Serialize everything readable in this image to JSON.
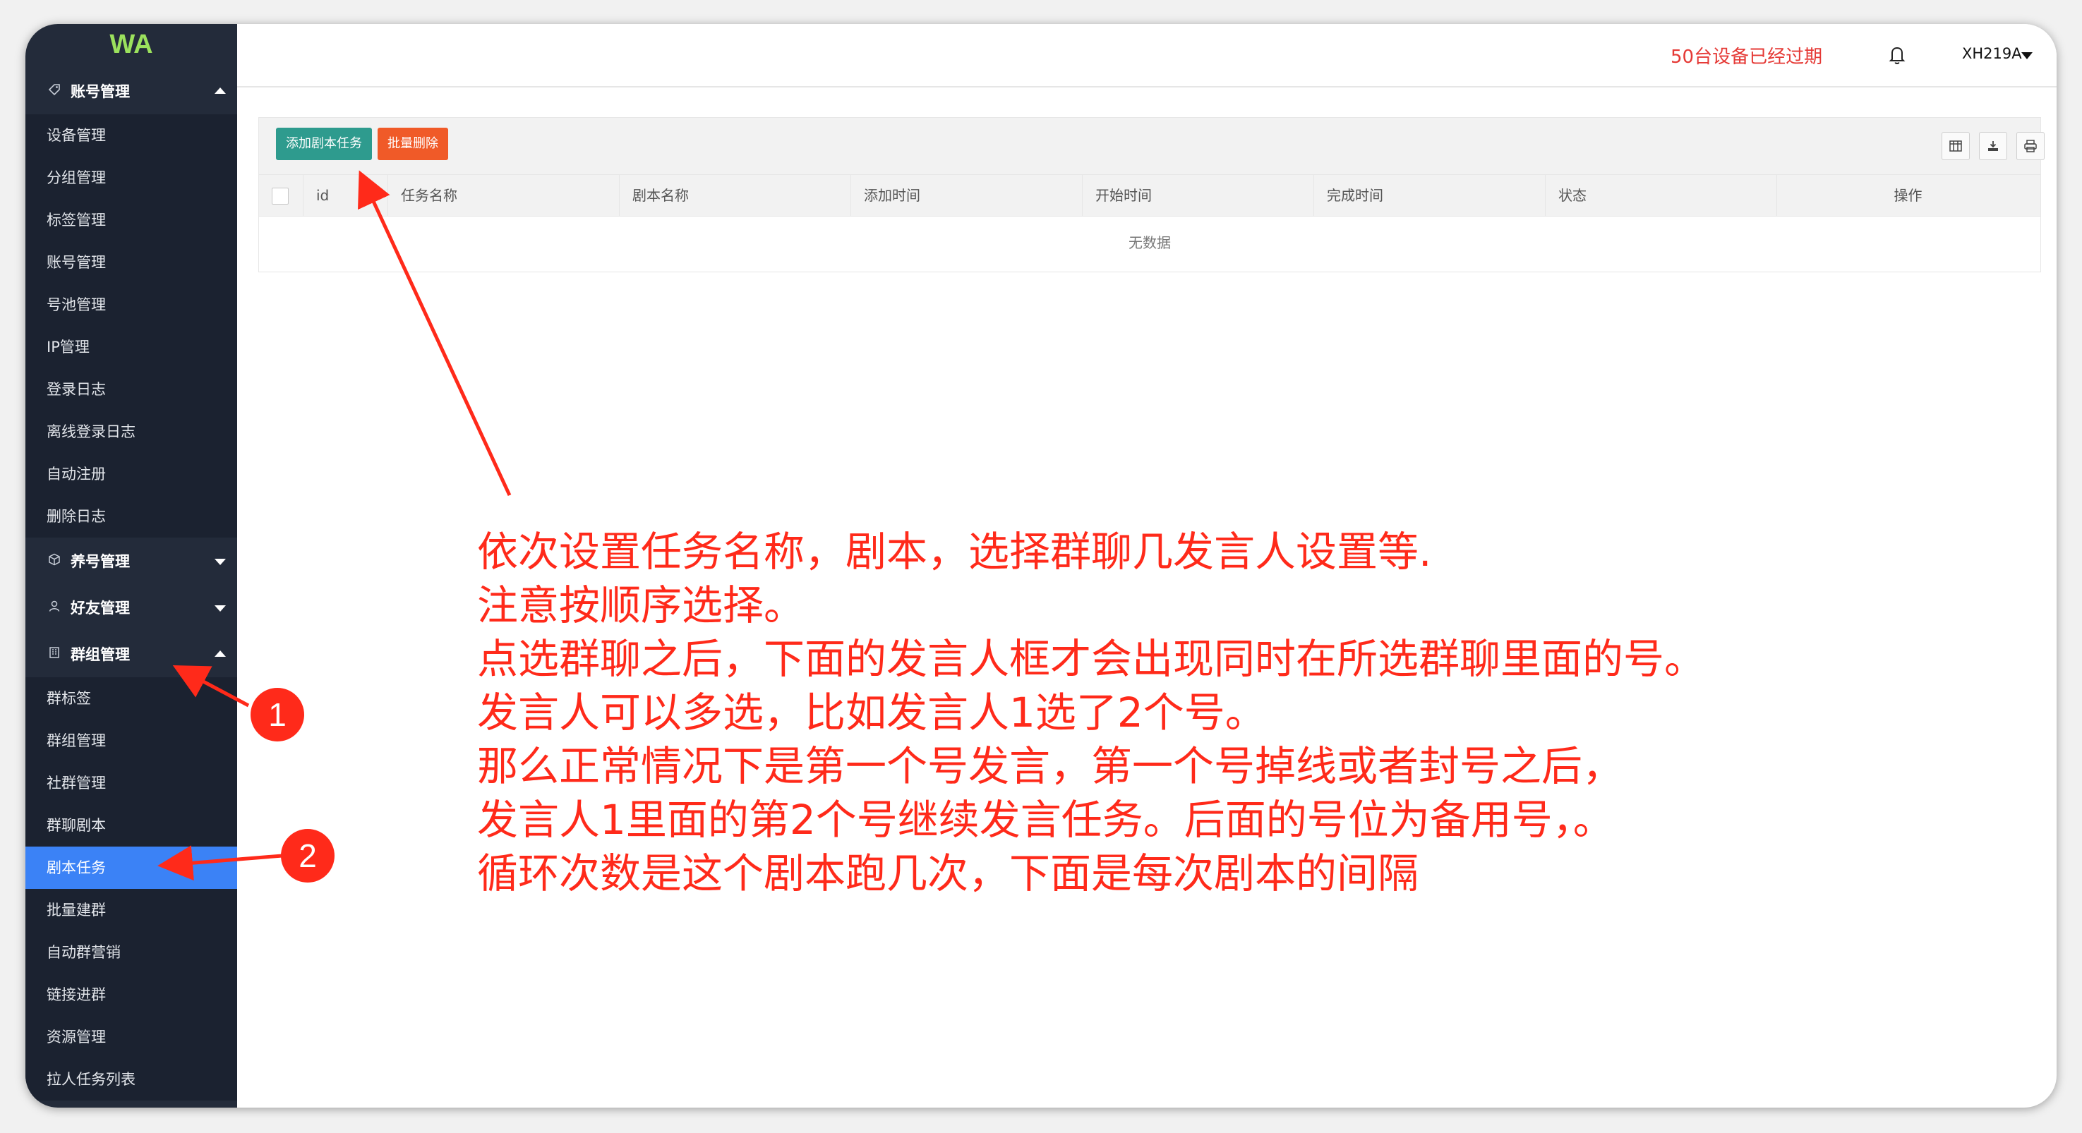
{
  "sidebar": {
    "logo": "WA",
    "groups": [
      {
        "label": "账号管理",
        "icon": "tag-icon",
        "expanded": true,
        "items": [
          "设备管理",
          "分组管理",
          "标签管理",
          "账号管理",
          "号池管理",
          "IP管理",
          "登录日志",
          "离线登录日志",
          "自动注册",
          "删除日志"
        ]
      },
      {
        "label": "养号管理",
        "icon": "cube-icon",
        "expanded": false,
        "items": []
      },
      {
        "label": "好友管理",
        "icon": "user-icon",
        "expanded": false,
        "items": []
      },
      {
        "label": "群组管理",
        "icon": "building-icon",
        "expanded": true,
        "items": [
          "群标签",
          "群组管理",
          "社群管理",
          "群聊剧本",
          "剧本任务",
          "批量建群",
          "自动群营销",
          "链接进群",
          "资源管理",
          "拉人任务列表"
        ],
        "active_item": "剧本任务"
      }
    ]
  },
  "header": {
    "expired_notice": "50台设备已经过期",
    "bell_icon": "bell-icon",
    "username": "XH219A"
  },
  "toolbar": {
    "add_label": "添加剧本任务",
    "delete_label": "批量删除",
    "add_color": "#2e9b8e",
    "delete_color": "#f05a28",
    "tools": [
      "columns-icon",
      "export-icon",
      "print-icon"
    ]
  },
  "table": {
    "columns": [
      "id",
      "任务名称",
      "剧本名称",
      "添加时间",
      "开始时间",
      "完成时间",
      "状态",
      "操作"
    ],
    "empty_text": "无数据"
  },
  "annotation": {
    "color": "#ff2a1a",
    "lines": [
      "依次设置任务名称，剧本，选择群聊几发言人设置等.",
      "注意按顺序选择。",
      "点选群聊之后，下面的发言人框才会出现同时在所选群聊里面的号。",
      "发言人可以多选，比如发言人1选了2个号。",
      "那么正常情况下是第一个号发言，第一个号掉线或者封号之后，",
      "发言人1里面的第2个号继续发言任务。后面的号位为备用号，。",
      "循环次数是这个剧本跑几次，下面是每次剧本的间隔"
    ],
    "badges": [
      "1",
      "2"
    ]
  }
}
